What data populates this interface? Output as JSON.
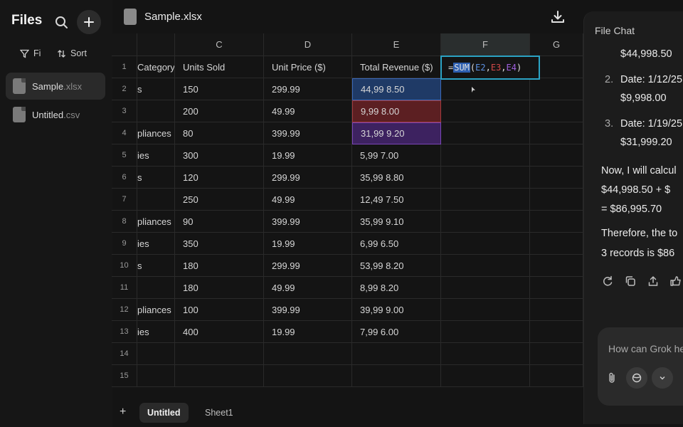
{
  "sidebar": {
    "title": "Files",
    "filter_label": "Fi",
    "sort_label": "Sort",
    "files": [
      {
        "name": "Sample",
        "ext": ".xlsx"
      },
      {
        "name": "Untitled",
        "ext": ".csv"
      }
    ]
  },
  "header": {
    "title": "Sample.xlsx"
  },
  "grid": {
    "columns": [
      "C",
      "D",
      "E",
      "F",
      "G"
    ],
    "rows": [
      {
        "n": "1",
        "b": "Category",
        "c": "Units Sold",
        "d": "Unit Price ($)",
        "e": "Total Revenue ($)"
      },
      {
        "n": "2",
        "b": "s",
        "c": "150",
        "d": "299.99",
        "e": "44,99 8.50"
      },
      {
        "n": "3",
        "b": "",
        "c": "200",
        "d": "49.99",
        "e": "9,99 8.00"
      },
      {
        "n": "4",
        "b": "pliances",
        "c": "80",
        "d": "399.99",
        "e": "31,99 9.20"
      },
      {
        "n": "5",
        "b": "ies",
        "c": "300",
        "d": "19.99",
        "e": "5,99 7.00"
      },
      {
        "n": "6",
        "b": "s",
        "c": "120",
        "d": "299.99",
        "e": "35,99 8.80"
      },
      {
        "n": "7",
        "b": "",
        "c": "250",
        "d": "49.99",
        "e": "12,49 7.50"
      },
      {
        "n": "8",
        "b": "pliances",
        "c": "90",
        "d": "399.99",
        "e": "35,99 9.10"
      },
      {
        "n": "9",
        "b": "ies",
        "c": "350",
        "d": "19.99",
        "e": "6,99 6.50"
      },
      {
        "n": "10",
        "b": "s",
        "c": "180",
        "d": "299.99",
        "e": "53,99 8.20"
      },
      {
        "n": "11",
        "b": "",
        "c": "180",
        "d": "49.99",
        "e": "8,99 8.20"
      },
      {
        "n": "12",
        "b": "pliances",
        "c": "100",
        "d": "399.99",
        "e": "39,99 9.00"
      },
      {
        "n": "13",
        "b": "ies",
        "c": "400",
        "d": "19.99",
        "e": "7,99 6.00"
      },
      {
        "n": "14",
        "b": "",
        "c": "",
        "d": "",
        "e": ""
      },
      {
        "n": "15",
        "b": "",
        "c": "",
        "d": "",
        "e": ""
      }
    ],
    "formula": {
      "eq": "=",
      "fn": "SUM",
      "open": "(",
      "a1": "E2",
      "comma1": ",",
      "a2": "E3",
      "comma2": ",",
      "a3": "E4",
      "close": ")"
    },
    "highlight_colors": {
      "e2": "#1f3a66",
      "e3": "#5c1f22",
      "e4": "#3d2260",
      "active_cell": "#2ba3c4"
    }
  },
  "sheets": {
    "add_label": "+",
    "tabs": [
      "Untitled",
      "Sheet1"
    ]
  },
  "chat": {
    "title": "File Chat",
    "lines": [
      "$44,998.50",
      "2.",
      "Date: 1/12/25",
      "$9,998.00",
      "3.",
      "Date: 1/19/25",
      "$31,999.20",
      "Now, I will calcul",
      "$44,998.50 + $",
      "= $86,995.70",
      "Therefore, the to",
      "3 records is $86"
    ],
    "input_placeholder": "How can Grok he"
  }
}
